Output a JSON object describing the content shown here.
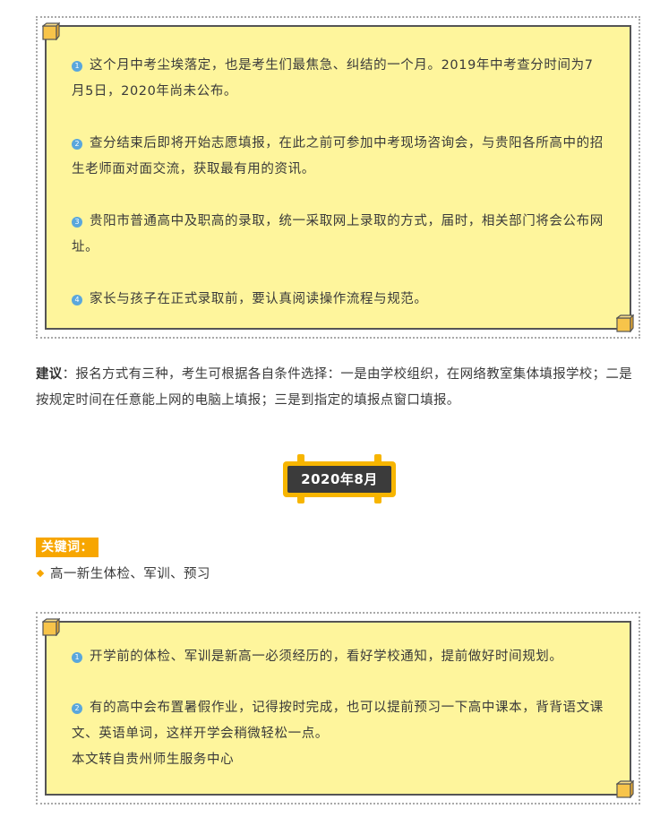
{
  "note1": {
    "items": [
      {
        "num": "1",
        "text": "这个月中考尘埃落定，也是考生们最焦急、纠结的一个月。2019年中考查分时间为7月5日，2020年尚未公布。"
      },
      {
        "num": "2",
        "text": "查分结束后即将开始志愿填报，在此之前可参加中考现场咨询会，与贵阳各所高中的招生老师面对面交流，获取最有用的资讯。"
      },
      {
        "num": "3",
        "text": "贵阳市普通高中及职高的录取，统一采取网上录取的方式，届时，相关部门将会公布网址。"
      },
      {
        "num": "4",
        "text": "家长与孩子在正式录取前，要认真阅读操作流程与规范。"
      }
    ]
  },
  "advice": {
    "label": "建议",
    "text": "：报名方式有三种，考生可根据各自条件选择：一是由学校组织，在网络教室集体填报学校；二是按规定时间在任意能上网的电脑上填报；三是到指定的填报点窗口填报。"
  },
  "month_banner": {
    "label": "2020年8月"
  },
  "keywords": {
    "label": "关键词：",
    "item": "高一新生体检、军训、预习"
  },
  "note2": {
    "items": [
      {
        "num": "1",
        "text": "开学前的体检、军训是新高一必须经历的，看好学校通知，提前做好时间规划。"
      },
      {
        "num": "2",
        "text": "有的高中会布置暑假作业，记得按时完成，也可以提前预习一下高中课本，背背语文课文、英语单词，这样开学会稍微轻松一点。"
      }
    ],
    "source": "本文转自贵州师生服务中心"
  },
  "colors": {
    "note_bg": "#fef59c",
    "accent_orange": "#f7a600",
    "bullet_blue": "#5aa7dc",
    "banner_dark": "#3b3b3b"
  }
}
